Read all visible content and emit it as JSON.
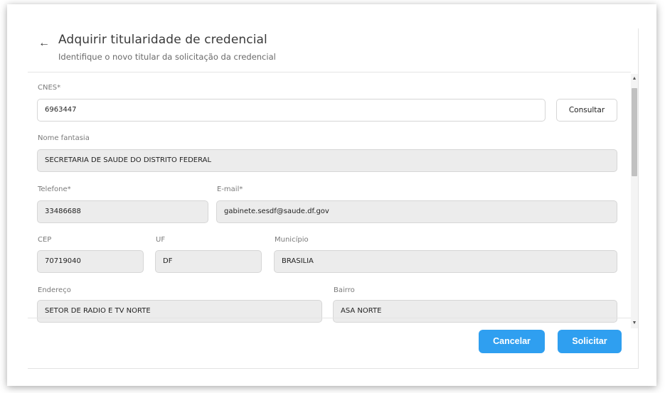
{
  "header": {
    "back_icon": "arrow-left-icon",
    "title": "Adquirir titularidade de credencial",
    "subtitle": "Identifique o novo titular da solicitação da credencial"
  },
  "form": {
    "cnes": {
      "label": "CNES*",
      "value": "6963447"
    },
    "consultar_label": "Consultar",
    "nome_fantasia": {
      "label": "Nome fantasia",
      "value": "SECRETARIA DE SAUDE DO DISTRITO FEDERAL"
    },
    "telefone": {
      "label": "Telefone*",
      "value": "33486688"
    },
    "email": {
      "label": "E-mail*",
      "value": "gabinete.sesdf@saude.df.gov"
    },
    "cep": {
      "label": "CEP",
      "value": "70719040"
    },
    "uf": {
      "label": "UF",
      "value": "DF"
    },
    "municipio": {
      "label": "Município",
      "value": "BRASILIA"
    },
    "endereco": {
      "label": "Endereço",
      "value": "SETOR DE RADIO E TV NORTE"
    },
    "bairro": {
      "label": "Bairro",
      "value": "ASA NORTE"
    }
  },
  "actions": {
    "cancel_label": "Cancelar",
    "submit_label": "Solicitar"
  },
  "colors": {
    "primary_button": "#2f9ff0",
    "readonly_field": "#ececec"
  }
}
